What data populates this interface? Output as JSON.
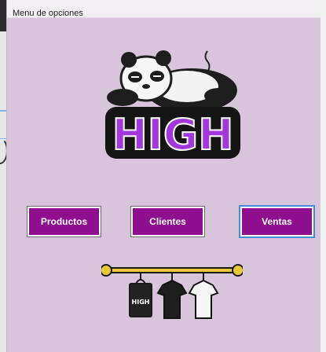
{
  "window": {
    "title": "Menu de opciones"
  },
  "logo": {
    "text": "HIGH",
    "alt": "sleeping-panda"
  },
  "buttons": {
    "productos": "Productos",
    "clientes": "Clientes",
    "ventas": "Ventas"
  },
  "illustration": {
    "bag_text": "HIGH"
  },
  "colors": {
    "background": "#d8c5dc",
    "button": "#8e0e8f",
    "accent": "#9d2bd6",
    "focus": "#4a88d8"
  }
}
